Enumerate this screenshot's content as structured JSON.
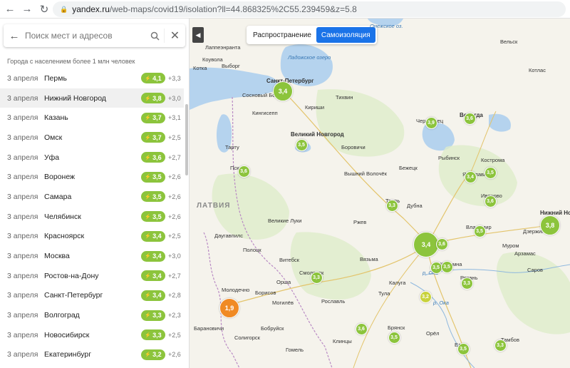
{
  "browser": {
    "back": "←",
    "forward": "→",
    "reload": "↻",
    "url_host": "yandex.ru",
    "url_rest": "/web-maps/covid19/isolation?ll=44.868325%2C55.239459&z=5.8"
  },
  "search": {
    "placeholder": "Поиск мест и адресов"
  },
  "list_caption": "Города с населением более 1 млн человек",
  "cities": [
    {
      "date": "3 апреля",
      "name": "Пермь",
      "index": "4,1",
      "delta": "+3,3"
    },
    {
      "date": "3 апреля",
      "name": "Нижний Новгород",
      "index": "3,8",
      "delta": "+3,0"
    },
    {
      "date": "3 апреля",
      "name": "Казань",
      "index": "3,7",
      "delta": "+3,1"
    },
    {
      "date": "3 апреля",
      "name": "Омск",
      "index": "3,7",
      "delta": "+2,5"
    },
    {
      "date": "3 апреля",
      "name": "Уфа",
      "index": "3,6",
      "delta": "+2,7"
    },
    {
      "date": "3 апреля",
      "name": "Воронеж",
      "index": "3,5",
      "delta": "+2,6"
    },
    {
      "date": "3 апреля",
      "name": "Самара",
      "index": "3,5",
      "delta": "+2,6"
    },
    {
      "date": "3 апреля",
      "name": "Челябинск",
      "index": "3,5",
      "delta": "+2,6"
    },
    {
      "date": "3 апреля",
      "name": "Красноярск",
      "index": "3,4",
      "delta": "+2,5"
    },
    {
      "date": "3 апреля",
      "name": "Москва",
      "index": "3,4",
      "delta": "+3,0"
    },
    {
      "date": "3 апреля",
      "name": "Ростов-на-Дону",
      "index": "3,4",
      "delta": "+2,7"
    },
    {
      "date": "3 апреля",
      "name": "Санкт-Петербург",
      "index": "3,4",
      "delta": "+2,8"
    },
    {
      "date": "3 апреля",
      "name": "Волгоград",
      "index": "3,3",
      "delta": "+2,3"
    },
    {
      "date": "3 апреля",
      "name": "Новосибирск",
      "index": "3,3",
      "delta": "+2,5"
    },
    {
      "date": "3 апреля",
      "name": "Екатеринбург",
      "index": "3,2",
      "delta": "+2,6"
    }
  ],
  "map": {
    "tab_spread": "Распространение",
    "tab_isolation": "Самоизоляция",
    "places": [
      {
        "t": "Онежское оз.",
        "cls": "water"
      },
      {
        "t": "Вельск"
      },
      {
        "t": "Лаппеэнранта"
      },
      {
        "t": "Коувола"
      },
      {
        "t": "Котка"
      },
      {
        "t": "Выборг"
      },
      {
        "t": "Ладожское озеро",
        "cls": "water"
      },
      {
        "t": "Котлас"
      },
      {
        "t": "Санкт-Петербург",
        "cls": "bold"
      },
      {
        "t": "Тихвин"
      },
      {
        "t": "Сосновый Бор"
      },
      {
        "t": "Кингисепп"
      },
      {
        "t": "Кириши"
      },
      {
        "t": "Череповец"
      },
      {
        "t": "Вологда",
        "cls": "bold"
      },
      {
        "t": "Великий Новгород",
        "cls": "bold"
      },
      {
        "t": "Тарту"
      },
      {
        "t": "Боровичи"
      },
      {
        "t": "Рыбинск"
      },
      {
        "t": "Кострома"
      },
      {
        "t": "Псков"
      },
      {
        "t": "Бежецк"
      },
      {
        "t": "Вышний Волочёк"
      },
      {
        "t": "Ярославль"
      },
      {
        "t": "Иваново"
      },
      {
        "t": "Тверь"
      },
      {
        "t": "Дубна"
      },
      {
        "t": "ЛАТВИЯ",
        "cls": "country"
      },
      {
        "t": "Великие Луки"
      },
      {
        "t": "Ржев"
      },
      {
        "t": "Владимир"
      },
      {
        "t": "Нижний Новгород",
        "cls": "bold"
      },
      {
        "t": "Дзержинск"
      },
      {
        "t": "Даугавпилс"
      },
      {
        "t": "Полоцк"
      },
      {
        "t": "Витебск"
      },
      {
        "t": "Вязьма"
      },
      {
        "t": "Муром"
      },
      {
        "t": "Арзамас"
      },
      {
        "t": "Смоленск"
      },
      {
        "t": "Орша"
      },
      {
        "t": "Калуга"
      },
      {
        "t": "Коломна"
      },
      {
        "t": "Рязань"
      },
      {
        "t": "Саров"
      },
      {
        "t": "Молодечно"
      },
      {
        "t": "Борисов"
      },
      {
        "t": "Могилёв"
      },
      {
        "t": "Тула"
      },
      {
        "t": "Рославль"
      },
      {
        "t": "Барановичи"
      },
      {
        "t": "Солигорск"
      },
      {
        "t": "Бобруйск"
      },
      {
        "t": "Брянск"
      },
      {
        "t": "Орёл"
      },
      {
        "t": "Елец"
      },
      {
        "t": "Тамбов"
      },
      {
        "t": "Гомель"
      },
      {
        "t": "Клинцы"
      },
      {
        "t": "р. Ока",
        "cls": "water"
      },
      {
        "t": "р. Ока",
        "cls": "water"
      }
    ],
    "markers": [
      {
        "v": "3,4",
        "color": "#8cc43c",
        "big": 1
      },
      {
        "v": "3,9",
        "color": "#8cc43c"
      },
      {
        "v": "3,6",
        "color": "#8cc43c"
      },
      {
        "v": "3,5",
        "color": "#8cc43c"
      },
      {
        "v": "3,6",
        "color": "#8cc43c"
      },
      {
        "v": "3,4",
        "color": "#8cc43c"
      },
      {
        "v": "3,5",
        "color": "#8cc43c"
      },
      {
        "v": "3,6",
        "color": "#8cc43c"
      },
      {
        "v": "3,3",
        "color": "#8cc43c"
      },
      {
        "v": "3,5",
        "color": "#8cc43c"
      },
      {
        "v": "3,8",
        "color": "#8cc43c",
        "big": 1
      },
      {
        "v": "3,4",
        "color": "#8cc43c",
        "big": 2
      },
      {
        "v": "3,6",
        "color": "#8cc43c"
      },
      {
        "v": "3,5",
        "color": "#8cc43c"
      },
      {
        "v": "3,5",
        "color": "#8cc43c"
      },
      {
        "v": "3,3",
        "color": "#8cc43c"
      },
      {
        "v": "3,3",
        "color": "#8cc43c"
      },
      {
        "v": "3,2",
        "color": "#c8d23c"
      },
      {
        "v": "1,9",
        "color": "#f08a24",
        "big": 1
      },
      {
        "v": "3,6",
        "color": "#8cc43c"
      },
      {
        "v": "3,5",
        "color": "#8cc43c"
      },
      {
        "v": "3,5",
        "color": "#8cc43c"
      },
      {
        "v": "3,3",
        "color": "#8cc43c"
      }
    ]
  }
}
